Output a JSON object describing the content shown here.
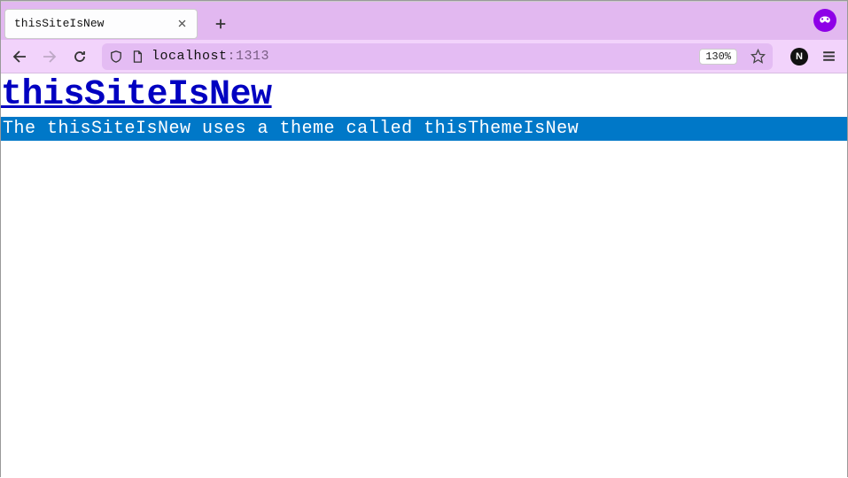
{
  "tabs": {
    "active": {
      "title": "thisSiteIsNew"
    }
  },
  "toolbar": {
    "url": {
      "host": "localhost",
      "port": ":1313"
    },
    "zoom": "130%",
    "profile_letter": "N"
  },
  "page": {
    "heading": "thisSiteIsNew",
    "subheading": "The thisSiteIsNew uses a theme called thisThemeIsNew"
  }
}
